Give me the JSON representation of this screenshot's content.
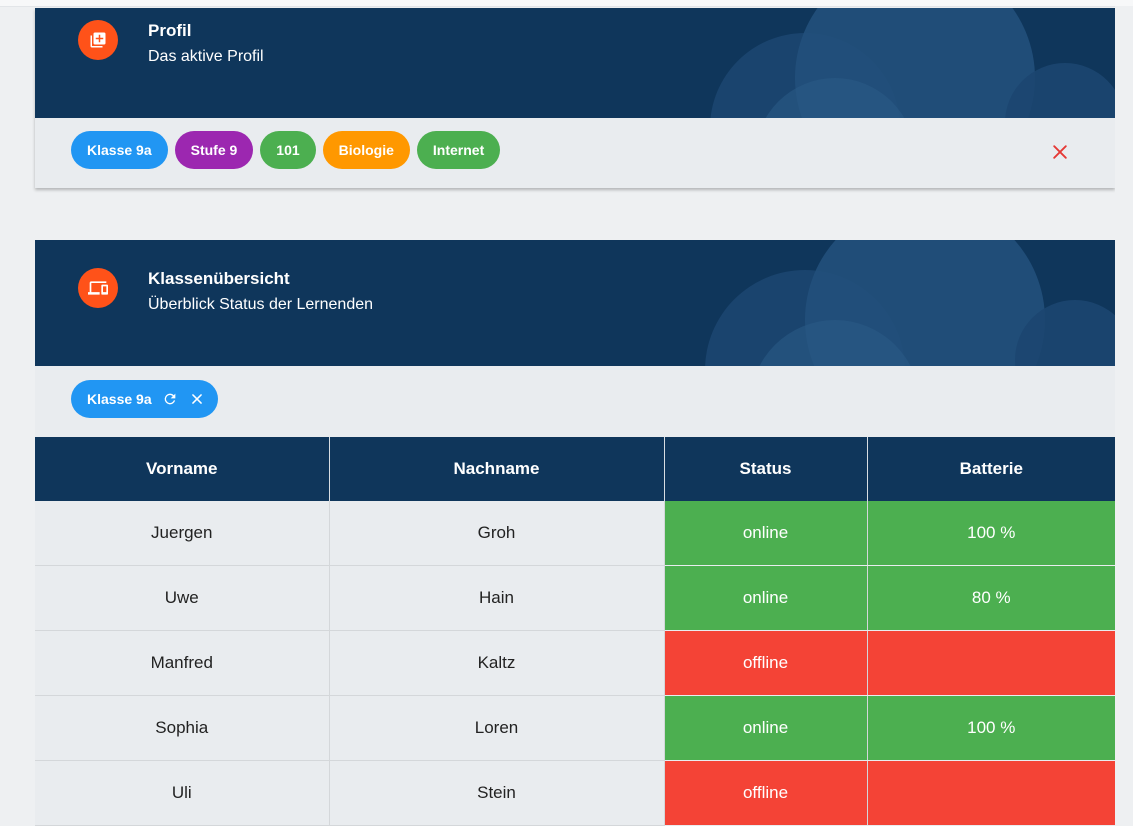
{
  "colors": {
    "header_bg": "#0f365b",
    "accent_orange": "#ff5219",
    "online": "#4caf50",
    "offline": "#f44336",
    "close_red": "#e53935"
  },
  "profile_card": {
    "icon": "library-add-icon",
    "title": "Profil",
    "subtitle": "Das aktive Profil",
    "chips": [
      {
        "label": "Klasse 9a",
        "color": "#2196f3"
      },
      {
        "label": "Stufe 9",
        "color": "#9c27b0"
      },
      {
        "label": "101",
        "color": "#4caf50"
      },
      {
        "label": "Biologie",
        "color": "#ff9800"
      },
      {
        "label": "Internet",
        "color": "#4caf50"
      }
    ],
    "close_icon": "close-icon"
  },
  "class_card": {
    "icon": "devices-icon",
    "title": "Klassenübersicht",
    "subtitle": "Überblick Status der Lernenden",
    "class_chip": {
      "label": "Klasse 9a",
      "color": "#2196f3",
      "refresh_icon": "refresh-icon",
      "close_icon": "close-icon"
    },
    "table": {
      "headers": [
        "Vorname",
        "Nachname",
        "Status",
        "Batterie"
      ],
      "rows": [
        {
          "first": "Juergen",
          "last": "Groh",
          "status": "online",
          "battery": "100 %"
        },
        {
          "first": "Uwe",
          "last": "Hain",
          "status": "online",
          "battery": "80 %"
        },
        {
          "first": "Manfred",
          "last": "Kaltz",
          "status": "offline",
          "battery": ""
        },
        {
          "first": "Sophia",
          "last": "Loren",
          "status": "online",
          "battery": "100 %"
        },
        {
          "first": "Uli",
          "last": "Stein",
          "status": "offline",
          "battery": ""
        }
      ]
    }
  }
}
